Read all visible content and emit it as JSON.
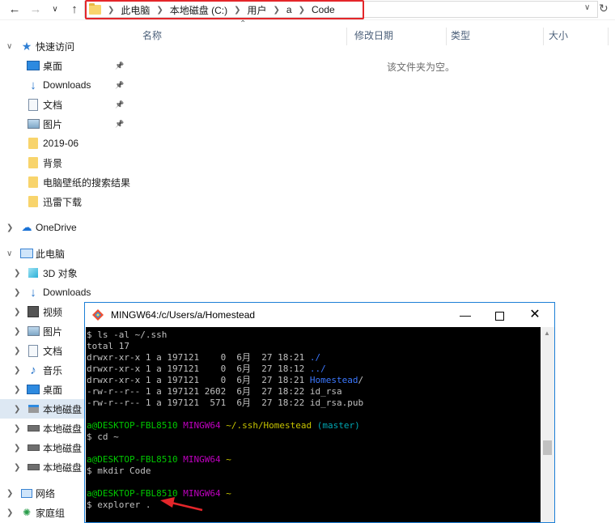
{
  "address_bar": {
    "segments": [
      "此电脑",
      "本地磁盘 (C:)",
      "用户",
      "a",
      "Code"
    ],
    "highlight_color": "#e4262a"
  },
  "nav_pane": {
    "quick_access": "快速访问",
    "quick_items": [
      {
        "label": "桌面",
        "icon": "desktop-icon"
      },
      {
        "label": "Downloads",
        "icon": "download-arrow-icon"
      },
      {
        "label": "文档",
        "icon": "document-icon"
      },
      {
        "label": "图片",
        "icon": "picture-icon"
      },
      {
        "label": "2019-06",
        "icon": "folder-icon"
      },
      {
        "label": "背景",
        "icon": "folder-icon"
      },
      {
        "label": "电脑壁纸的搜索结果",
        "icon": "folder-icon"
      },
      {
        "label": "迅雷下载",
        "icon": "folder-icon"
      }
    ],
    "onedrive": "OneDrive",
    "this_pc": "此电脑",
    "pc_items": [
      {
        "label": "3D 对象",
        "icon": "3d-objects-icon"
      },
      {
        "label": "Downloads",
        "icon": "download-arrow-icon"
      },
      {
        "label": "视频",
        "icon": "video-icon"
      },
      {
        "label": "图片",
        "icon": "picture-icon"
      },
      {
        "label": "文档",
        "icon": "document-icon"
      },
      {
        "label": "音乐",
        "icon": "music-note-icon"
      },
      {
        "label": "桌面",
        "icon": "desktop-icon"
      },
      {
        "label": "本地磁盘",
        "icon": "windows-drive-icon"
      },
      {
        "label": "本地磁盘",
        "icon": "drive-icon"
      },
      {
        "label": "本地磁盘",
        "icon": "drive-icon"
      },
      {
        "label": "本地磁盘",
        "icon": "drive-icon"
      }
    ],
    "network": "网络",
    "homegroup": "家庭组"
  },
  "content": {
    "columns": [
      "名称",
      "修改日期",
      "类型",
      "大小"
    ],
    "empty_message": "该文件夹为空。"
  },
  "terminal": {
    "title": "MINGW64:/c/Users/a/Homestead",
    "lines": [
      {
        "segments": [
          {
            "t": "$ ls -al ~/.ssh",
            "c": ""
          }
        ]
      },
      {
        "segments": [
          {
            "t": "total 17",
            "c": ""
          }
        ]
      },
      {
        "segments": [
          {
            "t": "drwxr-xr-x 1 a 197121    0  6月  27 18:21 ",
            "c": ""
          },
          {
            "t": "./",
            "c": "c-blue"
          }
        ]
      },
      {
        "segments": [
          {
            "t": "drwxr-xr-x 1 a 197121    0  6月  27 18:12 ",
            "c": ""
          },
          {
            "t": "../",
            "c": "c-blue"
          }
        ]
      },
      {
        "segments": [
          {
            "t": "drwxr-xr-x 1 a 197121    0  6月  27 18:21 ",
            "c": ""
          },
          {
            "t": "Homestead",
            "c": "c-blue"
          },
          {
            "t": "/",
            "c": ""
          }
        ]
      },
      {
        "segments": [
          {
            "t": "-rw-r--r-- 1 a 197121 2602  6月  27 18:22 id_rsa",
            "c": ""
          }
        ]
      },
      {
        "segments": [
          {
            "t": "-rw-r--r-- 1 a 197121  571  6月  27 18:22 id_rsa.pub",
            "c": ""
          }
        ]
      },
      {
        "segments": [
          {
            "t": "",
            "c": ""
          }
        ]
      },
      {
        "segments": [
          {
            "t": "a@DESKTOP-FBL8510 ",
            "c": "c-green"
          },
          {
            "t": "MINGW64 ",
            "c": "c-mag"
          },
          {
            "t": "~/.ssh/Homestead ",
            "c": "c-yel"
          },
          {
            "t": "(master)",
            "c": "c-cyan"
          }
        ]
      },
      {
        "segments": [
          {
            "t": "$ cd ~",
            "c": ""
          }
        ]
      },
      {
        "segments": [
          {
            "t": "",
            "c": ""
          }
        ]
      },
      {
        "segments": [
          {
            "t": "a@DESKTOP-FBL8510 ",
            "c": "c-green"
          },
          {
            "t": "MINGW64 ",
            "c": "c-mag"
          },
          {
            "t": "~",
            "c": "c-yel"
          }
        ]
      },
      {
        "segments": [
          {
            "t": "$ mkdir Code",
            "c": ""
          }
        ]
      },
      {
        "segments": [
          {
            "t": "",
            "c": ""
          }
        ]
      },
      {
        "segments": [
          {
            "t": "a@DESKTOP-FBL8510 ",
            "c": "c-green"
          },
          {
            "t": "MINGW64 ",
            "c": "c-mag"
          },
          {
            "t": "~",
            "c": "c-yel"
          }
        ]
      },
      {
        "segments": [
          {
            "t": "$ explorer .",
            "c": ""
          }
        ]
      },
      {
        "segments": [
          {
            "t": "",
            "c": ""
          }
        ]
      },
      {
        "segments": [
          {
            "t": "a@DESKTOP-FBL8510 ",
            "c": "c-green"
          },
          {
            "t": "MINGW64 ",
            "c": "c-mag"
          },
          {
            "t": "~",
            "c": "c-yel"
          }
        ]
      }
    ],
    "arrow_color": "#e4262a"
  }
}
